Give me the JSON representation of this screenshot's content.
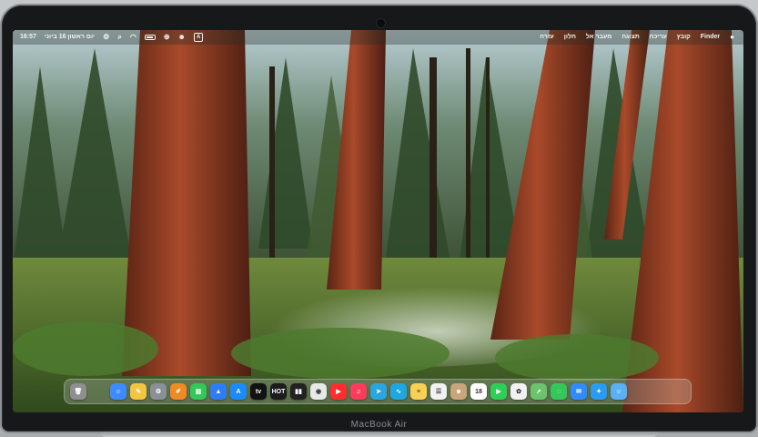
{
  "device": {
    "brand_label": "MacBook Air"
  },
  "menubar": {
    "apple_icon": "apple-logo-icon",
    "app_name": "Finder",
    "menus": [
      "קובץ",
      "עריכה",
      "תצוגה",
      "מעבר אל",
      "חלון",
      "עזרה"
    ],
    "clock": "16:57",
    "date": "יום ראשון 16 ביוני",
    "status_icons": [
      "control-center-icon",
      "search-icon",
      "wifi-icon",
      "battery-icon",
      "extension-icon",
      "profile-icon",
      "input-source-icon"
    ],
    "input_source_label": "A"
  },
  "dock": {
    "apps": [
      {
        "name": "trash",
        "glyph": "🗑",
        "color": "#8e8e93"
      },
      {
        "name": "finder",
        "glyph": "☺",
        "color": "#3d8bff"
      },
      {
        "name": "notes",
        "glyph": "✎",
        "color": "#f5c542"
      },
      {
        "name": "system-settings",
        "glyph": "⚙",
        "color": "#8a8f98"
      },
      {
        "name": "pages",
        "glyph": "✐",
        "color": "#f08a24"
      },
      {
        "name": "numbers",
        "glyph": "▥",
        "color": "#34c759"
      },
      {
        "name": "keynote",
        "glyph": "▲",
        "color": "#2f7df6"
      },
      {
        "name": "app-store",
        "glyph": "A",
        "color": "#1a8cff"
      },
      {
        "name": "apple-tv",
        "glyph": "tv",
        "color": "#111111"
      },
      {
        "name": "hot",
        "glyph": "HOT",
        "color": "#1c1c1c"
      },
      {
        "name": "yes-streaming",
        "glyph": "▮▮",
        "color": "#222222"
      },
      {
        "name": "chrome",
        "glyph": "◉",
        "color": "#e9e9e9"
      },
      {
        "name": "youtube",
        "glyph": "▶",
        "color": "#ff2d2d"
      },
      {
        "name": "music",
        "glyph": "♫",
        "color": "#fc3c5c"
      },
      {
        "name": "telegram",
        "glyph": "➤",
        "color": "#2aa6df"
      },
      {
        "name": "freeform",
        "glyph": "∿",
        "color": "#1ea7e0"
      },
      {
        "name": "notes-yellow",
        "glyph": "≡",
        "color": "#f7d154"
      },
      {
        "name": "reminders",
        "glyph": "☰",
        "color": "#f2f2f2"
      },
      {
        "name": "contacts",
        "glyph": "☻",
        "color": "#c9a57a"
      },
      {
        "name": "calendar",
        "glyph": "18",
        "color": "#ffffff"
      },
      {
        "name": "facetime",
        "glyph": "▶",
        "color": "#2fcf57"
      },
      {
        "name": "photos",
        "glyph": "✿",
        "color": "#f2f2f2"
      },
      {
        "name": "maps",
        "glyph": "➚",
        "color": "#6cc36b"
      },
      {
        "name": "messages",
        "glyph": "◌",
        "color": "#34c759"
      },
      {
        "name": "mail",
        "glyph": "✉",
        "color": "#2f8cff"
      },
      {
        "name": "safari",
        "glyph": "✦",
        "color": "#2a9bf2"
      },
      {
        "name": "finder-face",
        "glyph": "☺",
        "color": "#5ab0f5"
      }
    ]
  }
}
